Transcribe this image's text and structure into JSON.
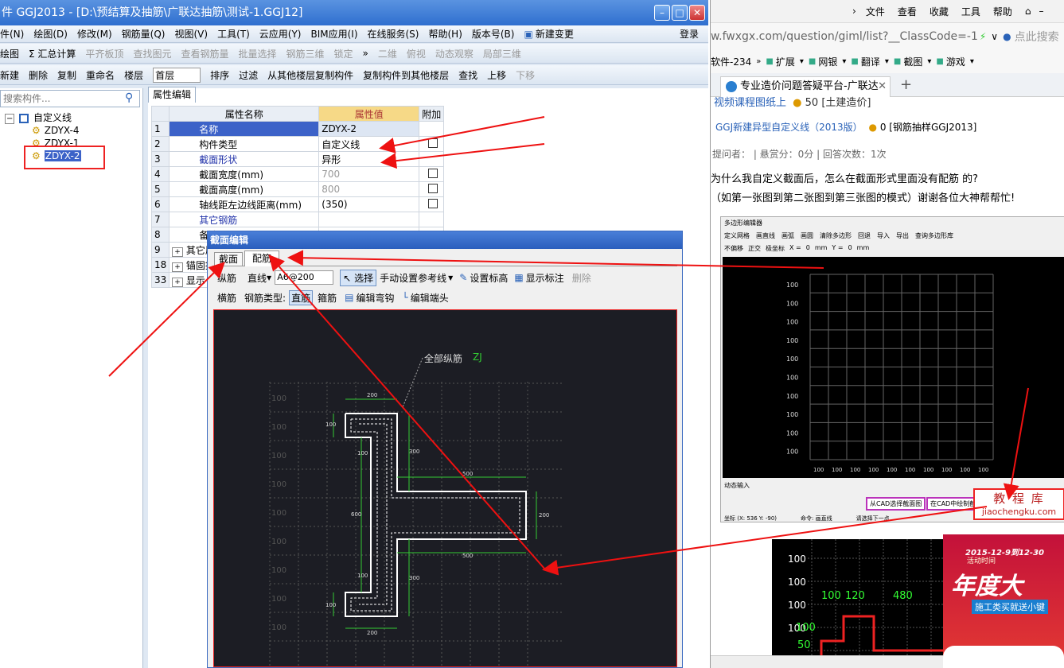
{
  "app": {
    "title": "件 GGJ2013 - [D:\\预结算及抽筋\\广联达抽筋\\测试-1.GGJ12]",
    "menu": [
      "件(N)",
      "绘图(D)",
      "修改(M)",
      "钢筋量(Q)",
      "视图(V)",
      "工具(T)",
      "云应用(Y)",
      "BIM应用(I)",
      "在线服务(S)",
      "帮助(H)",
      "版本号(B)"
    ],
    "menu_new_change": "新建变更",
    "login": "登录",
    "toolbar1": [
      "绘图",
      "Σ 汇总计算",
      "平齐板顶",
      "查找图元",
      "查看钢筋量",
      "批量选择",
      "钢筋三维",
      "锁定"
    ],
    "toolbar1_right": [
      "二维",
      "俯视",
      "动态观察",
      "局部三维"
    ],
    "toolbar2": [
      "新建",
      "删除",
      "复制",
      "重命名"
    ],
    "floor_label": "楼层",
    "floor_value": "首层",
    "toolbar2_b": [
      "排序",
      "过滤",
      "从其他楼层复制构件",
      "复制构件到其他楼层",
      "查找",
      "上移",
      "下移"
    ],
    "search_placeholder": "搜索构件...",
    "tree": {
      "root": "自定义线",
      "items": [
        "ZDYX-4",
        "ZDYX-1",
        "ZDYX-2"
      ]
    },
    "prop_tab": "属性编辑",
    "prop_headers": [
      "属性名称",
      "属性值",
      "附加"
    ],
    "props": [
      {
        "n": "1",
        "name": "名称",
        "val": "ZDYX-2",
        "cb": false,
        "blue": false
      },
      {
        "n": "2",
        "name": "构件类型",
        "val": "自定义线",
        "cb": true,
        "blue": false
      },
      {
        "n": "3",
        "name": "截面形状",
        "val": "异形",
        "cb": false,
        "blue": true
      },
      {
        "n": "4",
        "name": "截面宽度(mm)",
        "val": "700",
        "cb": true,
        "blue": false,
        "gray": true
      },
      {
        "n": "5",
        "name": "截面高度(mm)",
        "val": "800",
        "cb": true,
        "blue": false,
        "gray": true
      },
      {
        "n": "6",
        "name": "轴线距左边线距离(mm)",
        "val": "(350)",
        "cb": true,
        "blue": false
      },
      {
        "n": "7",
        "name": "其它钢筋",
        "val": "",
        "cb": false,
        "blue": true
      },
      {
        "n": "8",
        "name": "备注",
        "val": "",
        "cb": false,
        "blue": false
      },
      {
        "n": "9",
        "name": "其它属",
        "val": "",
        "cb": false,
        "blue": false,
        "plus": true
      },
      {
        "n": "18",
        "name": "锚固搭",
        "val": "",
        "cb": false,
        "blue": false,
        "plus": true
      },
      {
        "n": "33",
        "name": "显示",
        "val": "",
        "cb": false,
        "blue": false,
        "plus": true
      }
    ]
  },
  "dialog": {
    "title": "截面编辑",
    "tabs": [
      "截面",
      "配筋"
    ],
    "row1": {
      "zongjin": "纵筋",
      "line": "直线",
      "spec": "A6@200",
      "select": "选择",
      "manual": "手动设置参考线",
      "elev": "设置标高",
      "show": "显示标注",
      "delete": "删除"
    },
    "row2": {
      "hengjin": "横筋",
      "type_label": "钢筋类型:",
      "straight": "直筋",
      "stirrup": "箍筋",
      "bend": "编辑弯钩",
      "end": "编辑端头"
    },
    "canvas_label": "全部纵筋",
    "canvas_tag": "ZJ",
    "dims": [
      "200",
      "100",
      "100",
      "300",
      "500",
      "600",
      "200",
      "500",
      "100",
      "300",
      "100",
      "200"
    ],
    "grid_label": "100"
  },
  "browser": {
    "menu": [
      "文件",
      "查看",
      "收藏",
      "工具",
      "帮助"
    ],
    "url": "w.fwxgx.com/question/giml/list?__ClassCode=-1",
    "url_right": "点此搜索",
    "favbar": [
      "软件-234",
      "扩展",
      "网银",
      "翻译",
      "截图",
      "游戏"
    ],
    "tab_title": "专业造价问题答疑平台-广联达",
    "cut_text": "视频课程图纸上",
    "cut_score": "50",
    "cut_tag": "[土建造价]",
    "question_title": "GGJ新建异型自定义线（2013版）",
    "question_score": "0",
    "question_tag": "[钢筋抽样GGJ2013]",
    "meta": "提问者：   |   悬赏分：0分   |   回答次数：1次",
    "body1": "为什么我自定义截面后，怎么在截面形式里面没有配筋 的?",
    "body2": "（如第一张图到第二张图到第三张图的模式）谢谢各位大神帮帮忙!",
    "shot_title": "多边形编辑器",
    "shot_tools": [
      "定义网格",
      "画直线",
      "画弧",
      "画圆",
      "清除多边形",
      "回退",
      "导入",
      "导出",
      "查询多边形库"
    ],
    "shot_row2": [
      "不偏移",
      "正交",
      "极坐标",
      "X =",
      "0",
      "mm",
      "Y =",
      "0",
      "mm"
    ],
    "shot_grid": "100",
    "shot_bottom": "动态输入",
    "shot_btn1": "从CAD选择截面图",
    "shot_btn2": "在CAD中绘制截面",
    "shot_status": [
      "坐标 (X: 536 Y: -90)",
      "命令: 画直线",
      "请选择下一点"
    ],
    "watermark1": "教 程 库",
    "watermark2": "jiaochengku.com",
    "shot2_labels": [
      "100",
      "120",
      "480",
      "100",
      "50"
    ],
    "ad_date": "2015-12-9到12-30",
    "ad_sub": "活动时间",
    "ad_big": "年度大",
    "ad_small": "施工类买就送小键"
  }
}
